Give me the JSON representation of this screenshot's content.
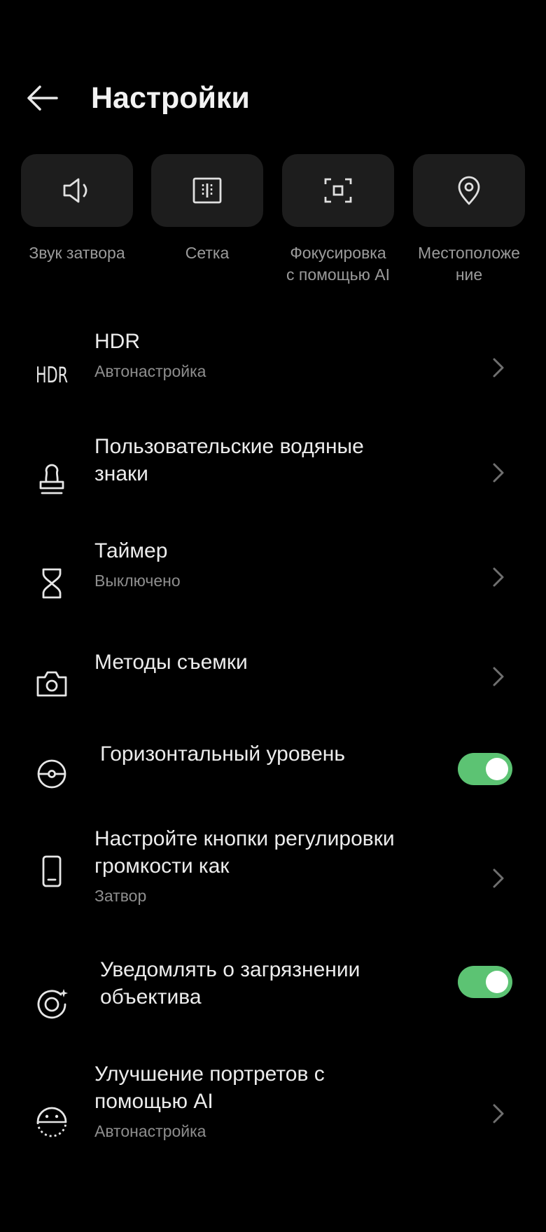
{
  "header": {
    "title": "Настройки",
    "back_icon": "arrow-left-icon"
  },
  "quick_tiles": [
    {
      "icon": "speaker-icon",
      "label": "Звук затвора"
    },
    {
      "icon": "grid-icon",
      "label": "Сетка"
    },
    {
      "icon": "focus-frame-icon",
      "label": "Фокусировка\nс помощью AI"
    },
    {
      "icon": "location-pin-icon",
      "label": "Местоположе\nние"
    }
  ],
  "settings": [
    {
      "icon": "hdr-icon",
      "title": "HDR",
      "subtitle": "Автонастройка",
      "control": "chevron"
    },
    {
      "icon": "watermark-stamp-icon",
      "title": "Пользовательские водяные\nзнаки",
      "control": "chevron"
    },
    {
      "icon": "hourglass-icon",
      "title": "Таймер",
      "subtitle": "Выключено",
      "control": "chevron"
    },
    {
      "icon": "camera-icon",
      "title": "Методы съемки",
      "control": "chevron"
    },
    {
      "icon": "level-icon",
      "title": "Горизонтальный уровень",
      "control": "toggle",
      "toggle_on": true
    },
    {
      "icon": "phone-icon",
      "title": "Настройте кнопки регулировки\nгромкости как",
      "subtitle": "Затвор",
      "control": "chevron"
    },
    {
      "icon": "lens-sparkle-icon",
      "title": "Уведомлять о загрязнении\nобъектива",
      "control": "toggle",
      "toggle_on": true
    },
    {
      "icon": "face-ai-icon",
      "title": "Улучшение портретов с\nпомощью AI",
      "subtitle": "Автонастройка",
      "control": "chevron"
    }
  ],
  "colors": {
    "background": "#000000",
    "tile": "#1d1d1d",
    "toggle_on": "#5cc373",
    "secondary_text": "#8e8e8e"
  }
}
